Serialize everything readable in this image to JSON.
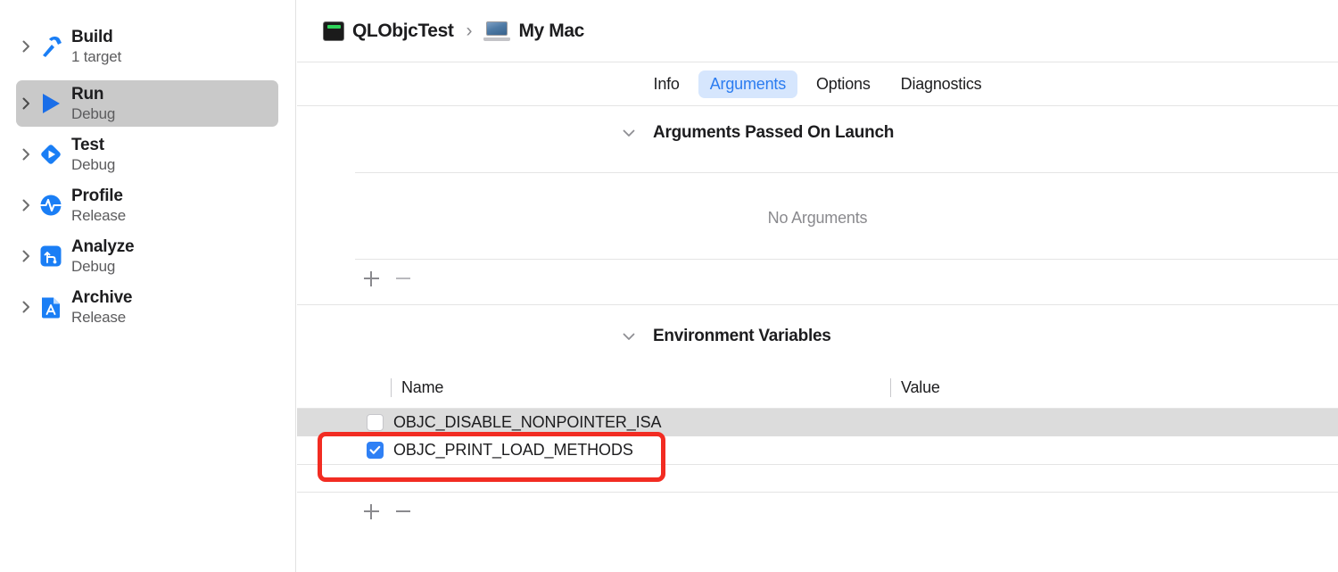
{
  "window": {
    "title": "Xcode Scheme Editor — Run / Arguments"
  },
  "colors": {
    "accent_blue": "#2b7cf0",
    "tab_active_bg": "#d6e6fd",
    "checkbox_on": "#2f80f5",
    "row_selected_gray": "#dcdcdc",
    "sidebar_selected_gray": "#c9c9c9",
    "annotation_red": "#f22c22",
    "separator": "#e4e4e4"
  },
  "sidebar": {
    "items": [
      {
        "label": "Build",
        "subtitle": "1 target",
        "icon": "hammer-icon",
        "selected": false
      },
      {
        "label": "Run",
        "subtitle": "Debug",
        "icon": "play-triangle-icon",
        "selected": true
      },
      {
        "label": "Test",
        "subtitle": "Debug",
        "icon": "test-diamond-icon",
        "selected": false
      },
      {
        "label": "Profile",
        "subtitle": "Release",
        "icon": "profile-pulse-icon",
        "selected": false
      },
      {
        "label": "Analyze",
        "subtitle": "Debug",
        "icon": "analyze-branch-icon",
        "selected": false
      },
      {
        "label": "Archive",
        "subtitle": "Release",
        "icon": "archive-doc-icon",
        "selected": false
      }
    ],
    "disclosure_icon": "chevron-right-icon"
  },
  "breadcrumb": {
    "scheme": "QLObjcTest",
    "scheme_icon": "terminal-app-icon",
    "separator": "›",
    "destination": "My Mac",
    "destination_icon": "macbook-icon"
  },
  "tabs": [
    {
      "label": "Info",
      "active": false
    },
    {
      "label": "Arguments",
      "active": true
    },
    {
      "label": "Options",
      "active": false
    },
    {
      "label": "Diagnostics",
      "active": false
    }
  ],
  "arguments_section": {
    "title": "Arguments Passed On Launch",
    "chevron_icon": "chevron-down-icon",
    "empty_text": "No Arguments",
    "add_button": "+",
    "remove_button": "−"
  },
  "environment_section": {
    "title": "Environment Variables",
    "chevron_icon": "chevron-down-icon",
    "columns": [
      "Name",
      "Value"
    ],
    "rows": [
      {
        "name": "OBJC_DISABLE_NONPOINTER_ISA",
        "value": "",
        "checked": false,
        "highlighted_row": true,
        "annotated": false
      },
      {
        "name": "OBJC_PRINT_LOAD_METHODS",
        "value": "",
        "checked": true,
        "highlighted_row": false,
        "annotated": true
      }
    ],
    "add_button": "+",
    "remove_button": "−"
  }
}
